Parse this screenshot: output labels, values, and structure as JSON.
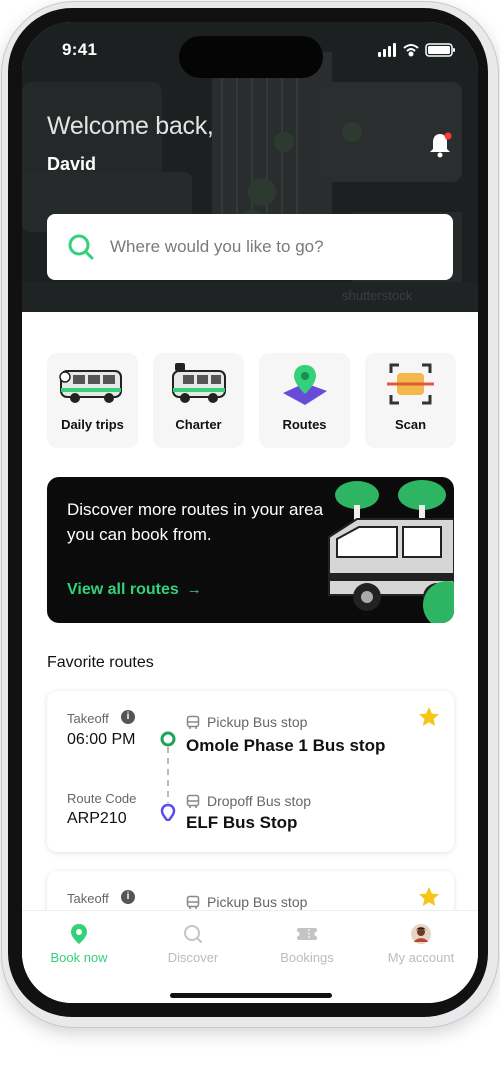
{
  "status_bar": {
    "time": "9:41"
  },
  "header": {
    "greeting": "Welcome back,",
    "user_name": "David",
    "watermark": "shutterstock"
  },
  "search": {
    "placeholder": "Where would you like to go?"
  },
  "quick_actions": [
    {
      "label": "Daily trips",
      "icon": "bus-icon"
    },
    {
      "label": "Charter",
      "icon": "charter-bus-icon"
    },
    {
      "label": "Routes",
      "icon": "map-pin-icon"
    },
    {
      "label": "Scan",
      "icon": "scan-icon"
    }
  ],
  "promo": {
    "text": "Discover more routes in your area you can book from.",
    "link_label": "View all routes",
    "link_arrow": "→"
  },
  "favorites": {
    "title": "Favorite routes",
    "routes": [
      {
        "takeoff_label": "Takeoff",
        "takeoff_time": "06:00 PM",
        "route_code_label": "Route Code",
        "route_code": "ARP210",
        "pickup_label": "Pickup Bus stop",
        "pickup_name": "Omole Phase 1 Bus stop",
        "dropoff_label": "Dropoff Bus stop",
        "dropoff_name": "ELF Bus Stop",
        "favorite": true
      },
      {
        "takeoff_label": "Takeoff",
        "pickup_label": "Pickup Bus stop",
        "favorite": true
      }
    ]
  },
  "bottom_nav": [
    {
      "label": "Book now",
      "icon": "location-pin-icon",
      "active": true
    },
    {
      "label": "Discover",
      "icon": "search-icon",
      "active": false
    },
    {
      "label": "Bookings",
      "icon": "ticket-icon",
      "active": false
    },
    {
      "label": "My account",
      "icon": "avatar",
      "active": false
    }
  ],
  "colors": {
    "accent": "#33d17a",
    "header_bg": "#1c1e1f",
    "star": "#f5c518",
    "dropoff_pin": "#5b4ee8"
  }
}
